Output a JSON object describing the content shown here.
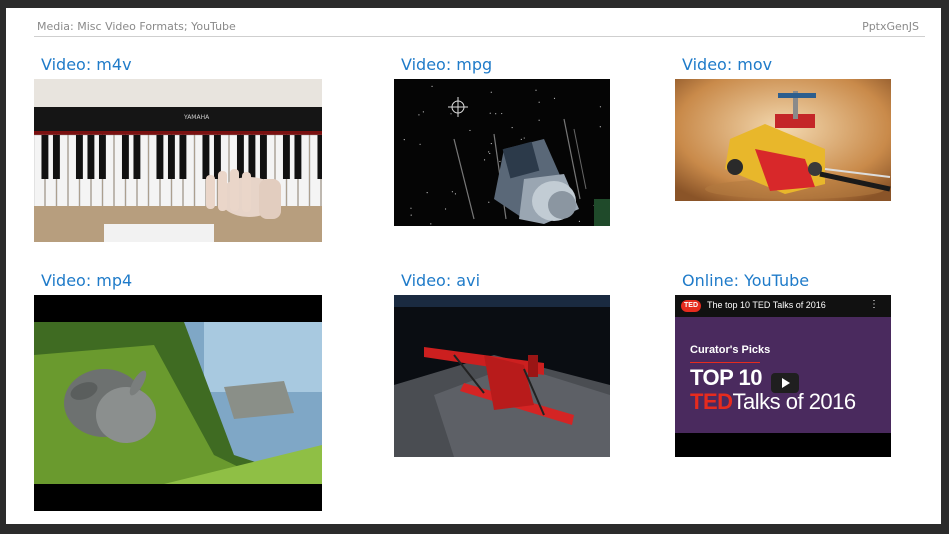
{
  "header": {
    "left_text": "Media: Misc Video Formats; YouTube",
    "right_text": "PptxGenJS"
  },
  "videos": [
    {
      "label": "Video: m4v",
      "brand": "YAMAHA"
    },
    {
      "label": "Video: mpg"
    },
    {
      "label": "Video: mov"
    },
    {
      "label": "Video: mp4"
    },
    {
      "label": "Video: avi"
    },
    {
      "label": "Online: YouTube",
      "yt_logo": "TED",
      "yt_title": "The top 10 TED Talks of 2016",
      "yt_menu": "⋮",
      "yt_subtitle": "Curator's Picks",
      "yt_line1": "TOP 10",
      "yt_line2_a": "TED",
      "yt_line2_b": "Talks of 2016"
    }
  ],
  "colors": {
    "label_blue": "#1f7bc9",
    "ted_red": "#e62b1e",
    "yt_purple": "#4a2a5e"
  }
}
